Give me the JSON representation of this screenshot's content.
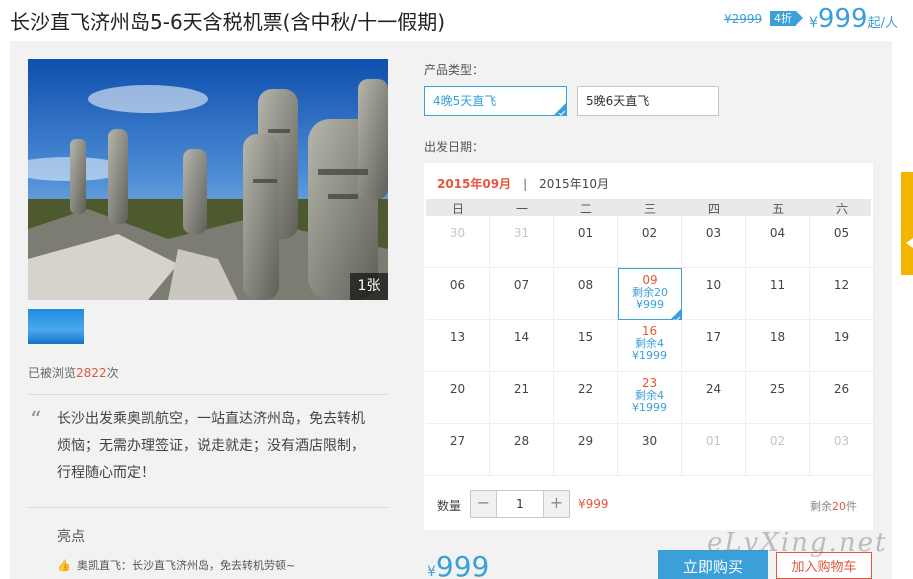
{
  "header": {
    "title": "长沙直飞济州岛5-6天含税机票(含中秋/十一假期)",
    "original_price": "¥2999",
    "discount": "4折",
    "price_symbol": "¥",
    "price": "999",
    "price_unit": "起/人"
  },
  "gallery": {
    "photo_count": "1张"
  },
  "views": {
    "prefix": "已被浏览",
    "count": "2822",
    "suffix": "次"
  },
  "description": {
    "text": "长沙出发乘奥凯航空，一站直达济州岛，免去转机烦恼；无需办理签证，说走就走；没有酒店限制，行程随心而定！"
  },
  "highlights": {
    "title": "亮点",
    "items": [
      "奥凯直飞：长沙直飞济州岛，免去转机劳顿~"
    ]
  },
  "product_type": {
    "label": "产品类型：",
    "options": [
      "4晚5天直飞",
      "5晚6天直飞"
    ],
    "selected_index": 0
  },
  "calendar": {
    "label": "出发日期：",
    "active_month": "2015年09月",
    "separator": "|",
    "other_month": "2015年10月",
    "weekdays": [
      "日",
      "一",
      "二",
      "三",
      "四",
      "五",
      "六"
    ],
    "weeks": [
      [
        {
          "d": "30",
          "muted": true
        },
        {
          "d": "31",
          "muted": true
        },
        {
          "d": "01"
        },
        {
          "d": "02"
        },
        {
          "d": "03"
        },
        {
          "d": "04"
        },
        {
          "d": "05"
        }
      ],
      [
        {
          "d": "06"
        },
        {
          "d": "07"
        },
        {
          "d": "08"
        },
        {
          "d": "09",
          "remain": "剩余20",
          "price": "¥999",
          "selected": true
        },
        {
          "d": "10"
        },
        {
          "d": "11"
        },
        {
          "d": "12"
        }
      ],
      [
        {
          "d": "13"
        },
        {
          "d": "14"
        },
        {
          "d": "15"
        },
        {
          "d": "16",
          "remain": "剩余4",
          "price": "¥1999"
        },
        {
          "d": "17"
        },
        {
          "d": "18"
        },
        {
          "d": "19"
        }
      ],
      [
        {
          "d": "20"
        },
        {
          "d": "21"
        },
        {
          "d": "22"
        },
        {
          "d": "23",
          "remain": "剩余4",
          "price": "¥1999"
        },
        {
          "d": "24"
        },
        {
          "d": "25"
        },
        {
          "d": "26"
        }
      ],
      [
        {
          "d": "27"
        },
        {
          "d": "28"
        },
        {
          "d": "29"
        },
        {
          "d": "30"
        },
        {
          "d": "01",
          "muted": true
        },
        {
          "d": "02",
          "muted": true
        },
        {
          "d": "03",
          "muted": true
        }
      ]
    ]
  },
  "quantity": {
    "label": "数量",
    "minus": "−",
    "value": "1",
    "plus": "+",
    "price": "¥999",
    "stock_prefix": "剩余",
    "stock_count": "20",
    "stock_suffix": "件"
  },
  "footer": {
    "price_symbol": "¥",
    "price": "999",
    "buy_label": "立即购买",
    "cart_label": "加入购物车"
  },
  "watermark": "eLvXing.net",
  "colors": {
    "accent_blue": "#3b9fd9",
    "accent_red": "#e4563d",
    "side_tab": "#f5b400"
  }
}
